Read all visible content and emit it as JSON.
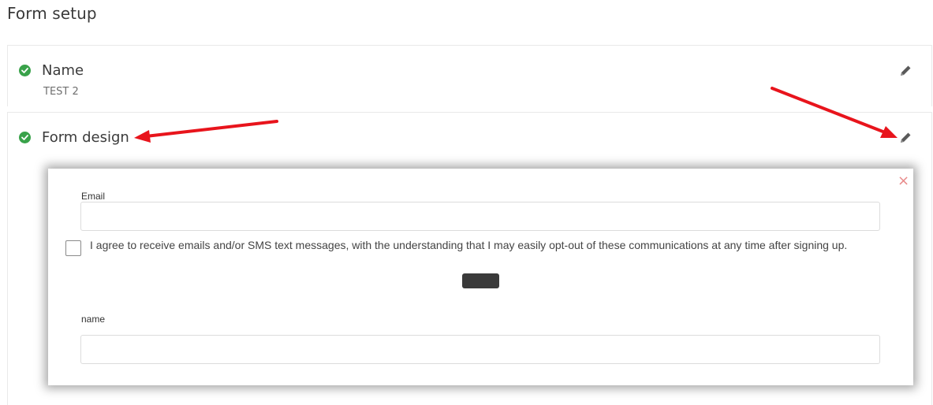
{
  "page": {
    "title": "Form setup"
  },
  "sections": {
    "name": {
      "title": "Name",
      "value": "TEST 2",
      "status": "complete"
    },
    "design": {
      "title": "Form design",
      "status": "complete"
    }
  },
  "form_preview": {
    "fields": [
      {
        "label": "Email",
        "value": ""
      },
      {
        "label": "name",
        "value": ""
      }
    ],
    "consent_text": "I agree to receive emails and/or SMS text messages, with the understanding that I may easily opt-out of these communications at any time after signing up.",
    "consent_checked": false,
    "close_icon": "×",
    "submit_label": ""
  },
  "icons": {
    "status": "check-circle-icon",
    "edit": "pencil-icon",
    "close": "close-icon"
  },
  "colors": {
    "success": "#39a24a",
    "annotation_arrow": "#e8141c",
    "close": "#e88a8a"
  }
}
